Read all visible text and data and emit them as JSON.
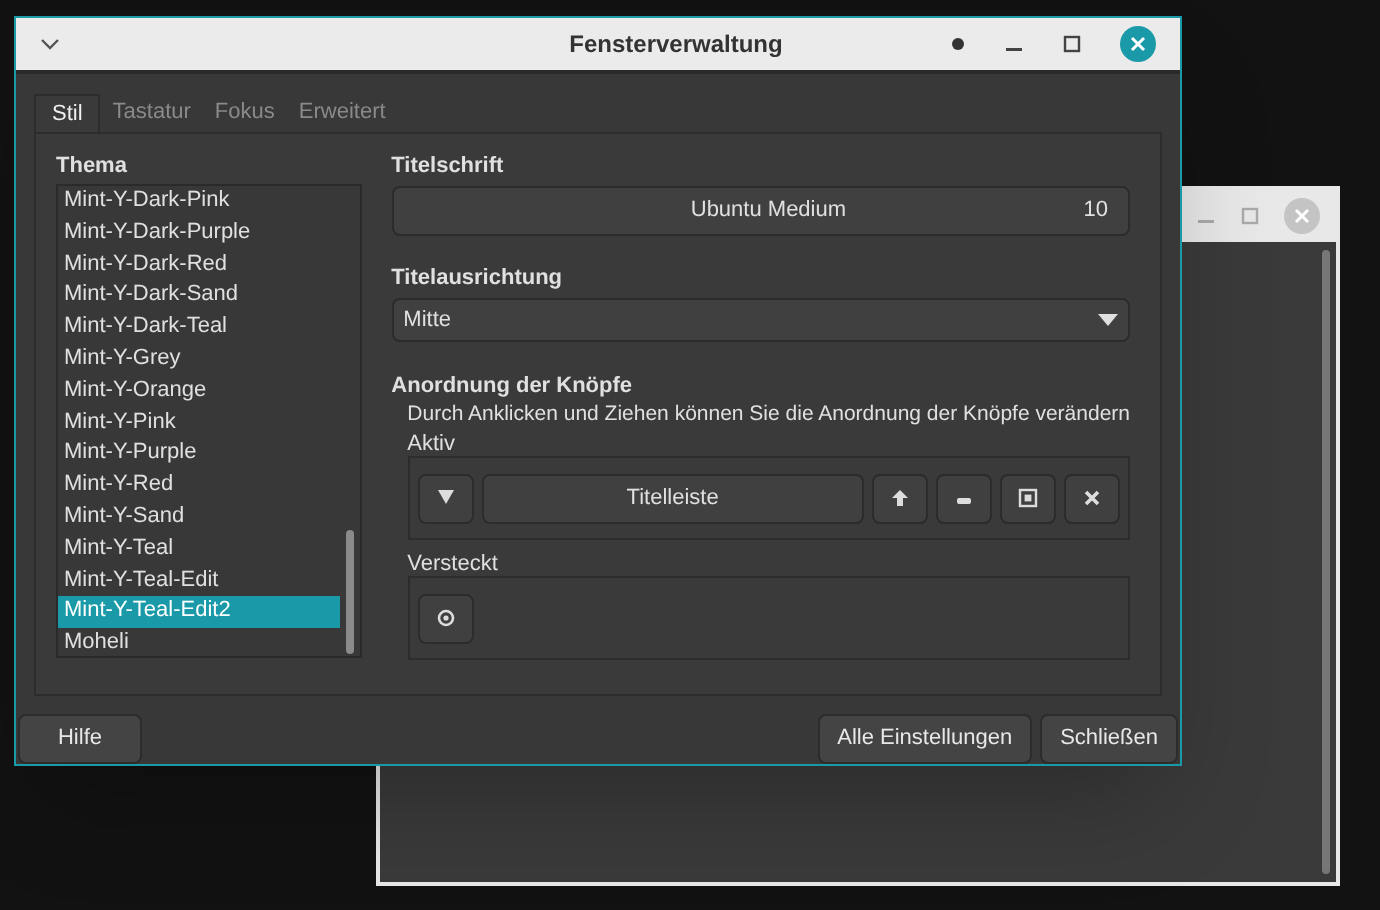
{
  "window": {
    "title": "Fensterverwaltung"
  },
  "tabs": [
    {
      "label": "Stil",
      "selected": true
    },
    {
      "label": "Tastatur",
      "selected": false
    },
    {
      "label": "Fokus",
      "selected": false
    },
    {
      "label": "Erweitert",
      "selected": false
    }
  ],
  "theme": {
    "label": "Thema",
    "items": [
      {
        "label": "Mint-Y-Dark-Pink",
        "selected": false
      },
      {
        "label": "Mint-Y-Dark-Purple",
        "selected": false
      },
      {
        "label": "Mint-Y-Dark-Red",
        "selected": false
      },
      {
        "label": "Mint-Y-Dark-Sand",
        "selected": false
      },
      {
        "label": "Mint-Y-Dark-Teal",
        "selected": false
      },
      {
        "label": "Mint-Y-Grey",
        "selected": false
      },
      {
        "label": "Mint-Y-Orange",
        "selected": false
      },
      {
        "label": "Mint-Y-Pink",
        "selected": false
      },
      {
        "label": "Mint-Y-Purple",
        "selected": false
      },
      {
        "label": "Mint-Y-Red",
        "selected": false
      },
      {
        "label": "Mint-Y-Sand",
        "selected": false
      },
      {
        "label": "Mint-Y-Teal",
        "selected": false
      },
      {
        "label": "Mint-Y-Teal-Edit",
        "selected": false
      },
      {
        "label": "Mint-Y-Teal-Edit2",
        "selected": true
      },
      {
        "label": "Moheli",
        "selected": false
      }
    ]
  },
  "title_font": {
    "label": "Titelschrift",
    "font": "Ubuntu Medium",
    "size": "10"
  },
  "title_alignment": {
    "label": "Titelausrichtung",
    "value": "Mitte"
  },
  "button_layout": {
    "label": "Anordnung der Knöpfe",
    "hint": "Durch Anklicken und Ziehen können Sie die Anordnung der Knöpfe verändern",
    "active": {
      "label": "Aktiv",
      "buttons": [
        {
          "kind": "menu"
        },
        {
          "kind": "title",
          "label": "Titelleiste"
        },
        {
          "kind": "above"
        },
        {
          "kind": "minimize"
        },
        {
          "kind": "maximize"
        },
        {
          "kind": "close"
        }
      ]
    },
    "hidden": {
      "label": "Versteckt",
      "buttons": [
        {
          "kind": "sticky"
        }
      ]
    }
  },
  "buttons": [
    {
      "label": "Hilfe"
    },
    {
      "label": "Alle Einstellungen"
    },
    {
      "label": "Schließen"
    }
  ]
}
